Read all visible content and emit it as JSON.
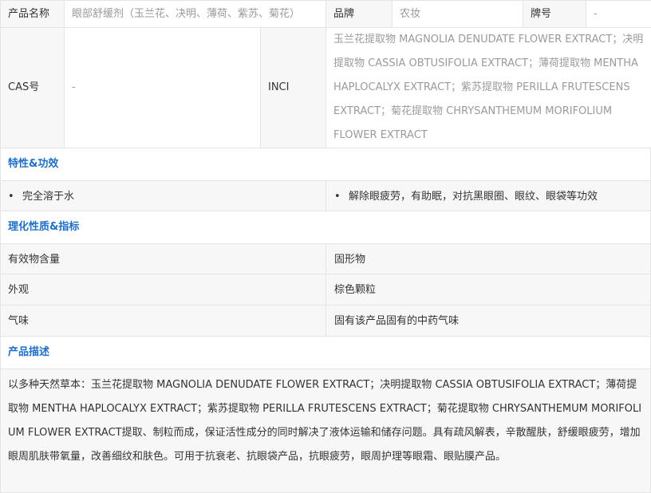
{
  "info": {
    "name_label": "产品名称",
    "name_value": "眼部舒缓剂（玉兰花、决明、薄荷、紫苏、菊花）",
    "brand_label": "品牌",
    "brand_value": "农妆",
    "model_label": "牌号",
    "model_value": "-",
    "cas_label": "CAS号",
    "cas_value": "-",
    "inci_label": "INCI",
    "inci_value": "玉兰花提取物 MAGNOLIA DENUDATE FLOWER EXTRACT；决明提取物 CASSIA OBTUSIFOLIA EXTRACT；薄荷提取物 MENTHA HAPLOCALYX EXTRACT；紫苏提取物 PERILLA FRUTESCENS EXTRACT；菊花提取物 CHRYSANTHEMUM MORIFOLIUM FLOWER EXTRACT"
  },
  "features": {
    "title": "特性&功效",
    "items": [
      "完全溶于水",
      "解除眼疲劳，有助眠，对抗黑眼圈、眼纹、眼袋等功效"
    ]
  },
  "properties": {
    "title": "理化性质&指标",
    "rows": [
      {
        "label": "有效物含量",
        "value": "固形物"
      },
      {
        "label": "外观",
        "value": "棕色颗粒"
      },
      {
        "label": "气味",
        "value": "固有该产品固有的中药气味"
      }
    ]
  },
  "description": {
    "title": "产品描述",
    "text": "以多种天然草本：玉兰花提取物 MAGNOLIA DENUDATE FLOWER EXTRACT；决明提取物 CASSIA OBTUSIFOLIA EXTRACT；薄荷提取物 MENTHA HAPLOCALYX EXTRACT；紫苏提取物 PERILLA FRUTESCENS EXTRACT；菊花提取物 CHRYSANTHEMUM MORIFOLIUM FLOWER EXTRACT提取、制粒而成，保证活性成分的同时解决了液体运输和储存问题。具有疏风解表，辛散醒肤，舒缓眼疲劳，增加眼周肌肤带氧量，改善细纹和肤色。可用于抗衰老、抗眼袋产品，抗眼疲劳，眼周护理等眼霜、眼贴膜产品。"
  },
  "colors": {
    "section_title": "#1f6fc8",
    "label_bg": "#f7f7f7",
    "border": "#e4e4e4",
    "muted_text": "#9a9a9a"
  }
}
